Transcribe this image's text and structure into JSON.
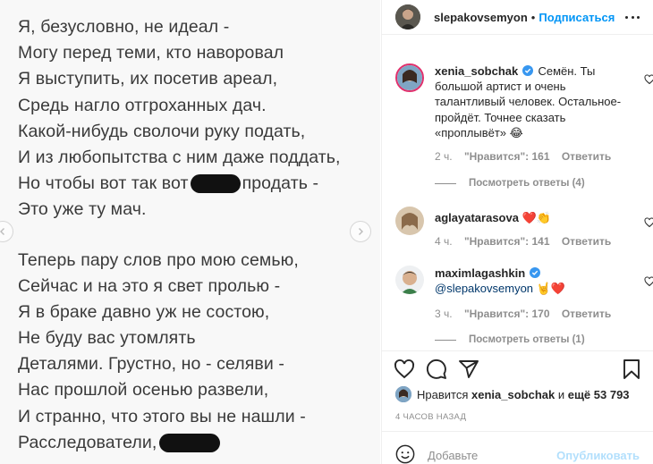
{
  "poem": {
    "lines": [
      "Я, безусловно, не идеал -",
      "Могу перед теми, кто наворовал",
      "Я выступить, их посетив ареал,",
      "Средь нагло отгроханных дач.",
      "Какой-нибудь сволочи руку подать,",
      "И из любопытства с ним даже поддать,",
      "Но чтобы вот так вот",
      "продать -",
      "Это уже ту мач.",
      "Теперь пару слов про мою семью,",
      "Сейчас и на это я свет пролью -",
      "Я в браке давно уж не состою,",
      "Не буду вас утомлять",
      "Деталями. Грустно, но - селяви -",
      "Нас прошлой осенью развели,",
      "И странно, что этого вы не нашли -",
      "Расследователи,"
    ]
  },
  "header": {
    "username": "slepakovsemyon",
    "separator": "•",
    "follow_label": "Подписаться"
  },
  "comments": [
    {
      "username": "xenia_sobchak",
      "text": "Семён. Ты большой артист и очень талантливый человек. Остальное-пройдёт. Точнее сказать «проплывёт» 😂",
      "time": "2 ч.",
      "likes": "\"Нравится\": 161",
      "reply": "Ответить",
      "view_replies": "Посмотреть ответы (4)"
    },
    {
      "username": "aglayatarasova",
      "text": "❤️👏",
      "time": "4 ч.",
      "likes": "\"Нравится\": 141",
      "reply": "Ответить"
    },
    {
      "username": "maximlagashkin",
      "mention": "@slepakovsemyon",
      "text": "🤘❤️",
      "time": "3 ч.",
      "likes": "\"Нравится\": 170",
      "reply": "Ответить",
      "view_replies": "Посмотреть ответы (1)"
    }
  ],
  "likes": {
    "prefix": "Нравится",
    "user": "xenia_sobchak",
    "middle": "и",
    "others": "ещё 53 793"
  },
  "timestamp": "4 ЧАСОВ НАЗАД",
  "comment_input": {
    "placeholder": "Добавьте",
    "publish_label": "Опубликовать"
  },
  "colors": {
    "accent": "#0095f6",
    "mention": "#00376b",
    "muted": "#8e8e8e",
    "publish_disabled": "#b2dffc"
  },
  "icons": [
    "chevron-left-icon",
    "chevron-right-icon",
    "more-icon",
    "verified-icon",
    "heart-icon",
    "comment-icon",
    "share-icon",
    "bookmark-icon",
    "emoji-icon"
  ]
}
